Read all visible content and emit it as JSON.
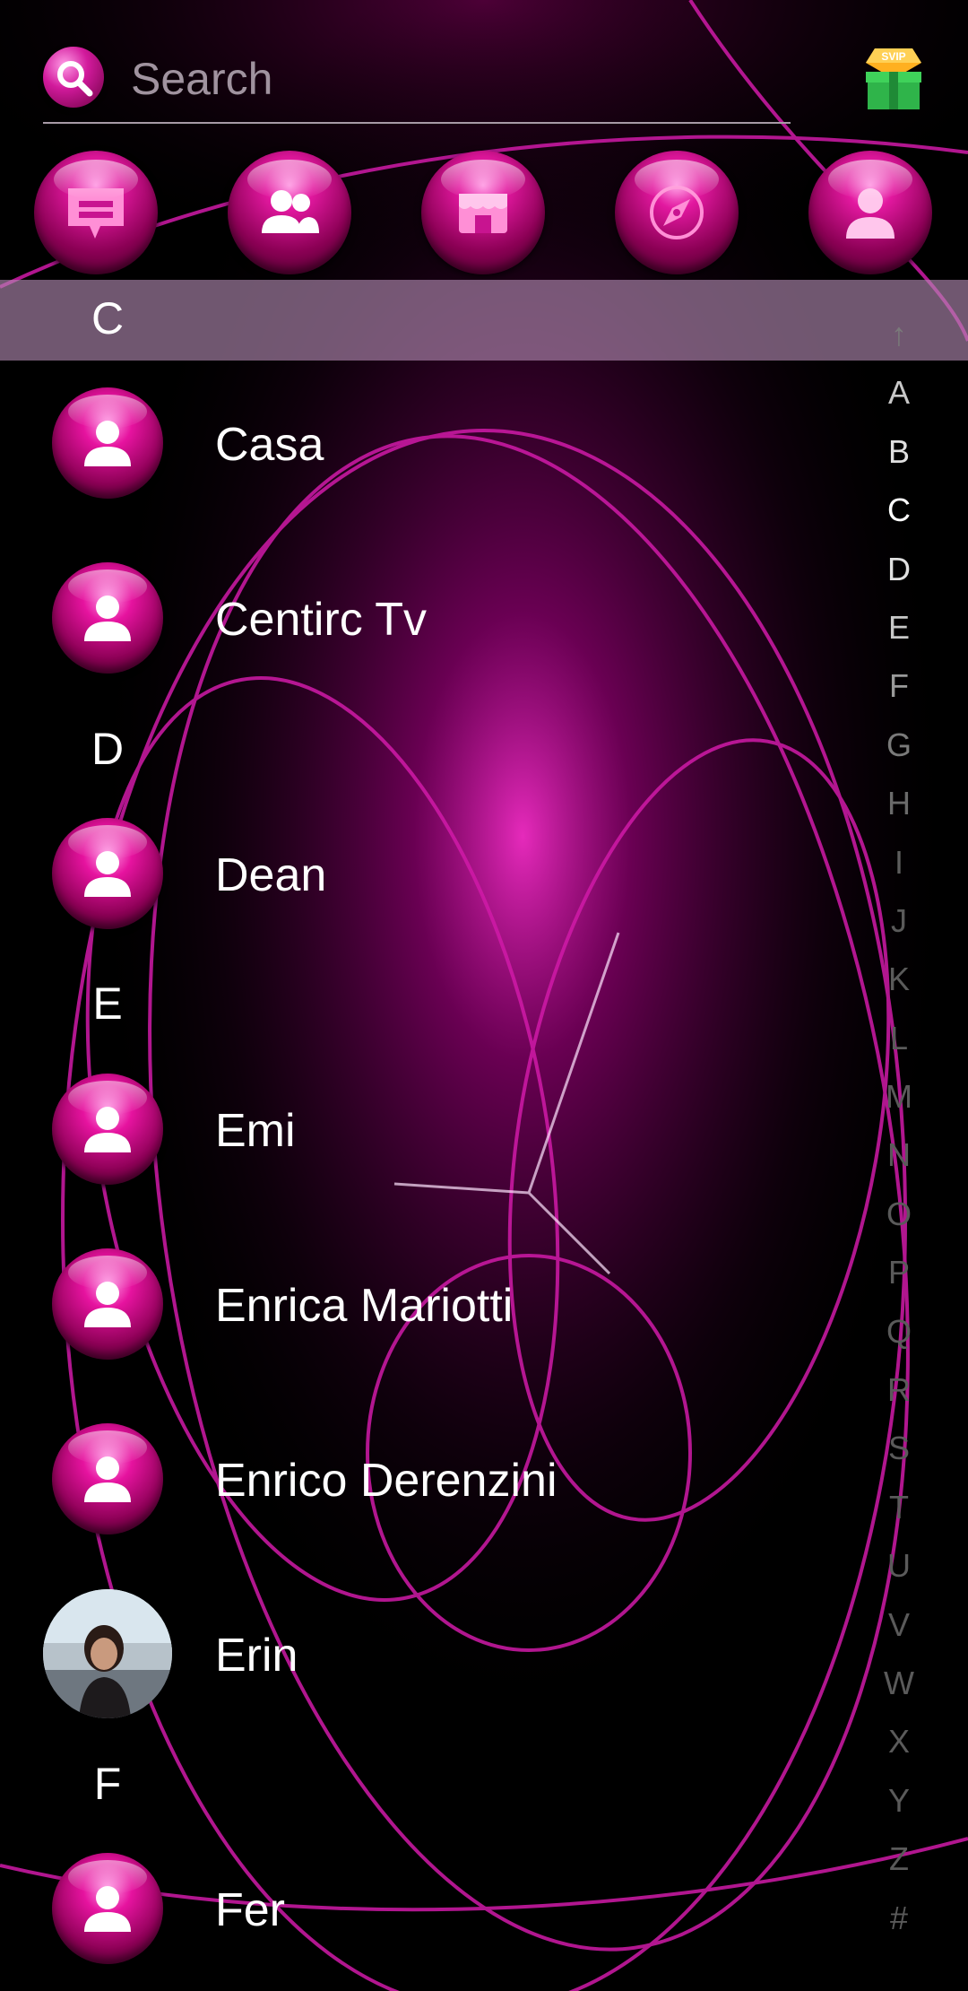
{
  "search": {
    "placeholder": "Search"
  },
  "promo": {
    "badge_text": "SVIP"
  },
  "tabs": [
    {
      "icon": "message-icon"
    },
    {
      "icon": "group-icon"
    },
    {
      "icon": "store-icon"
    },
    {
      "icon": "compass-icon"
    },
    {
      "icon": "profile-icon"
    }
  ],
  "sections": [
    {
      "letter": "C",
      "active": true
    },
    {
      "letter": "D"
    },
    {
      "letter": "E"
    },
    {
      "letter": "F"
    }
  ],
  "contacts": [
    {
      "name": "Casa",
      "section": "C"
    },
    {
      "name": "Centirc Tv",
      "section": "C"
    },
    {
      "name": "Dean",
      "section": "D"
    },
    {
      "name": "Emi",
      "section": "E"
    },
    {
      "name": "Enrica Mariotti",
      "section": "E"
    },
    {
      "name": "Enrico Derenzini",
      "section": "E"
    },
    {
      "name": "Erin",
      "section": "E",
      "has_photo": true
    },
    {
      "name": "Fer",
      "section": "F"
    }
  ],
  "alphabet_index": [
    "↑",
    "A",
    "B",
    "C",
    "D",
    "E",
    "F",
    "G",
    "H",
    "I",
    "J",
    "K",
    "L",
    "M",
    "N",
    "O",
    "P",
    "Q",
    "R",
    "S",
    "T",
    "U",
    "V",
    "W",
    "X",
    "Y",
    "Z",
    "#"
  ],
  "colors": {
    "accent": "#e6139f",
    "active_section_bar": "#b48cb4",
    "index_bright": "#ffffff",
    "index_dim": "#5a5a5a"
  }
}
